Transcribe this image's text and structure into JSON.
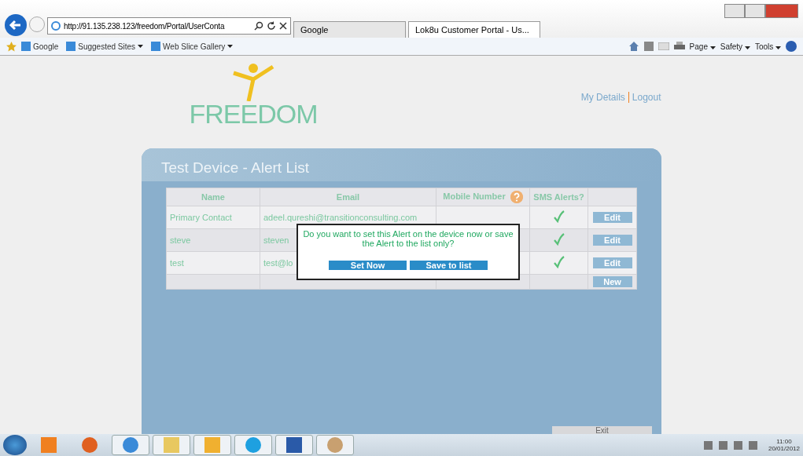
{
  "browser": {
    "address": "http://91.135.238.123/freedom/Portal/UserConta",
    "tabs": [
      {
        "label": "Google",
        "selected": false
      },
      {
        "label": "Lok8u Customer Portal - Us...",
        "selected": true
      }
    ],
    "favorites": [
      {
        "label": "Google",
        "menu": false
      },
      {
        "label": "Suggested Sites",
        "menu": true
      },
      {
        "label": "Web Slice Gallery",
        "menu": true
      }
    ],
    "commands": [
      "Page",
      "Safety",
      "Tools"
    ]
  },
  "header": {
    "logo": "FREEDOM",
    "links": [
      "My Details",
      "Logout"
    ]
  },
  "panel": {
    "title": "Test Device - Alert List",
    "table": {
      "columns": [
        "Name",
        "Email",
        "Mobile Number",
        "SMS Alerts?"
      ],
      "rows": [
        {
          "name": "Primary Contact",
          "email": "adeel.qureshi@transitionconsulting.com",
          "sms": true,
          "action": "Edit"
        },
        {
          "name": "steve",
          "email": "steven",
          "sms": true,
          "action": "Edit"
        },
        {
          "name": "test",
          "email": "test@lo",
          "sms": true,
          "action": "Edit"
        }
      ],
      "new_button": "New"
    },
    "exit_button": "Exit"
  },
  "dialog": {
    "message": "Do you want to set this Alert on the device now or save the Alert to the list only?",
    "buttons": [
      "Set Now",
      "Save to list"
    ]
  },
  "taskbar": {
    "time": "11:00",
    "date": "20/01/2012"
  }
}
